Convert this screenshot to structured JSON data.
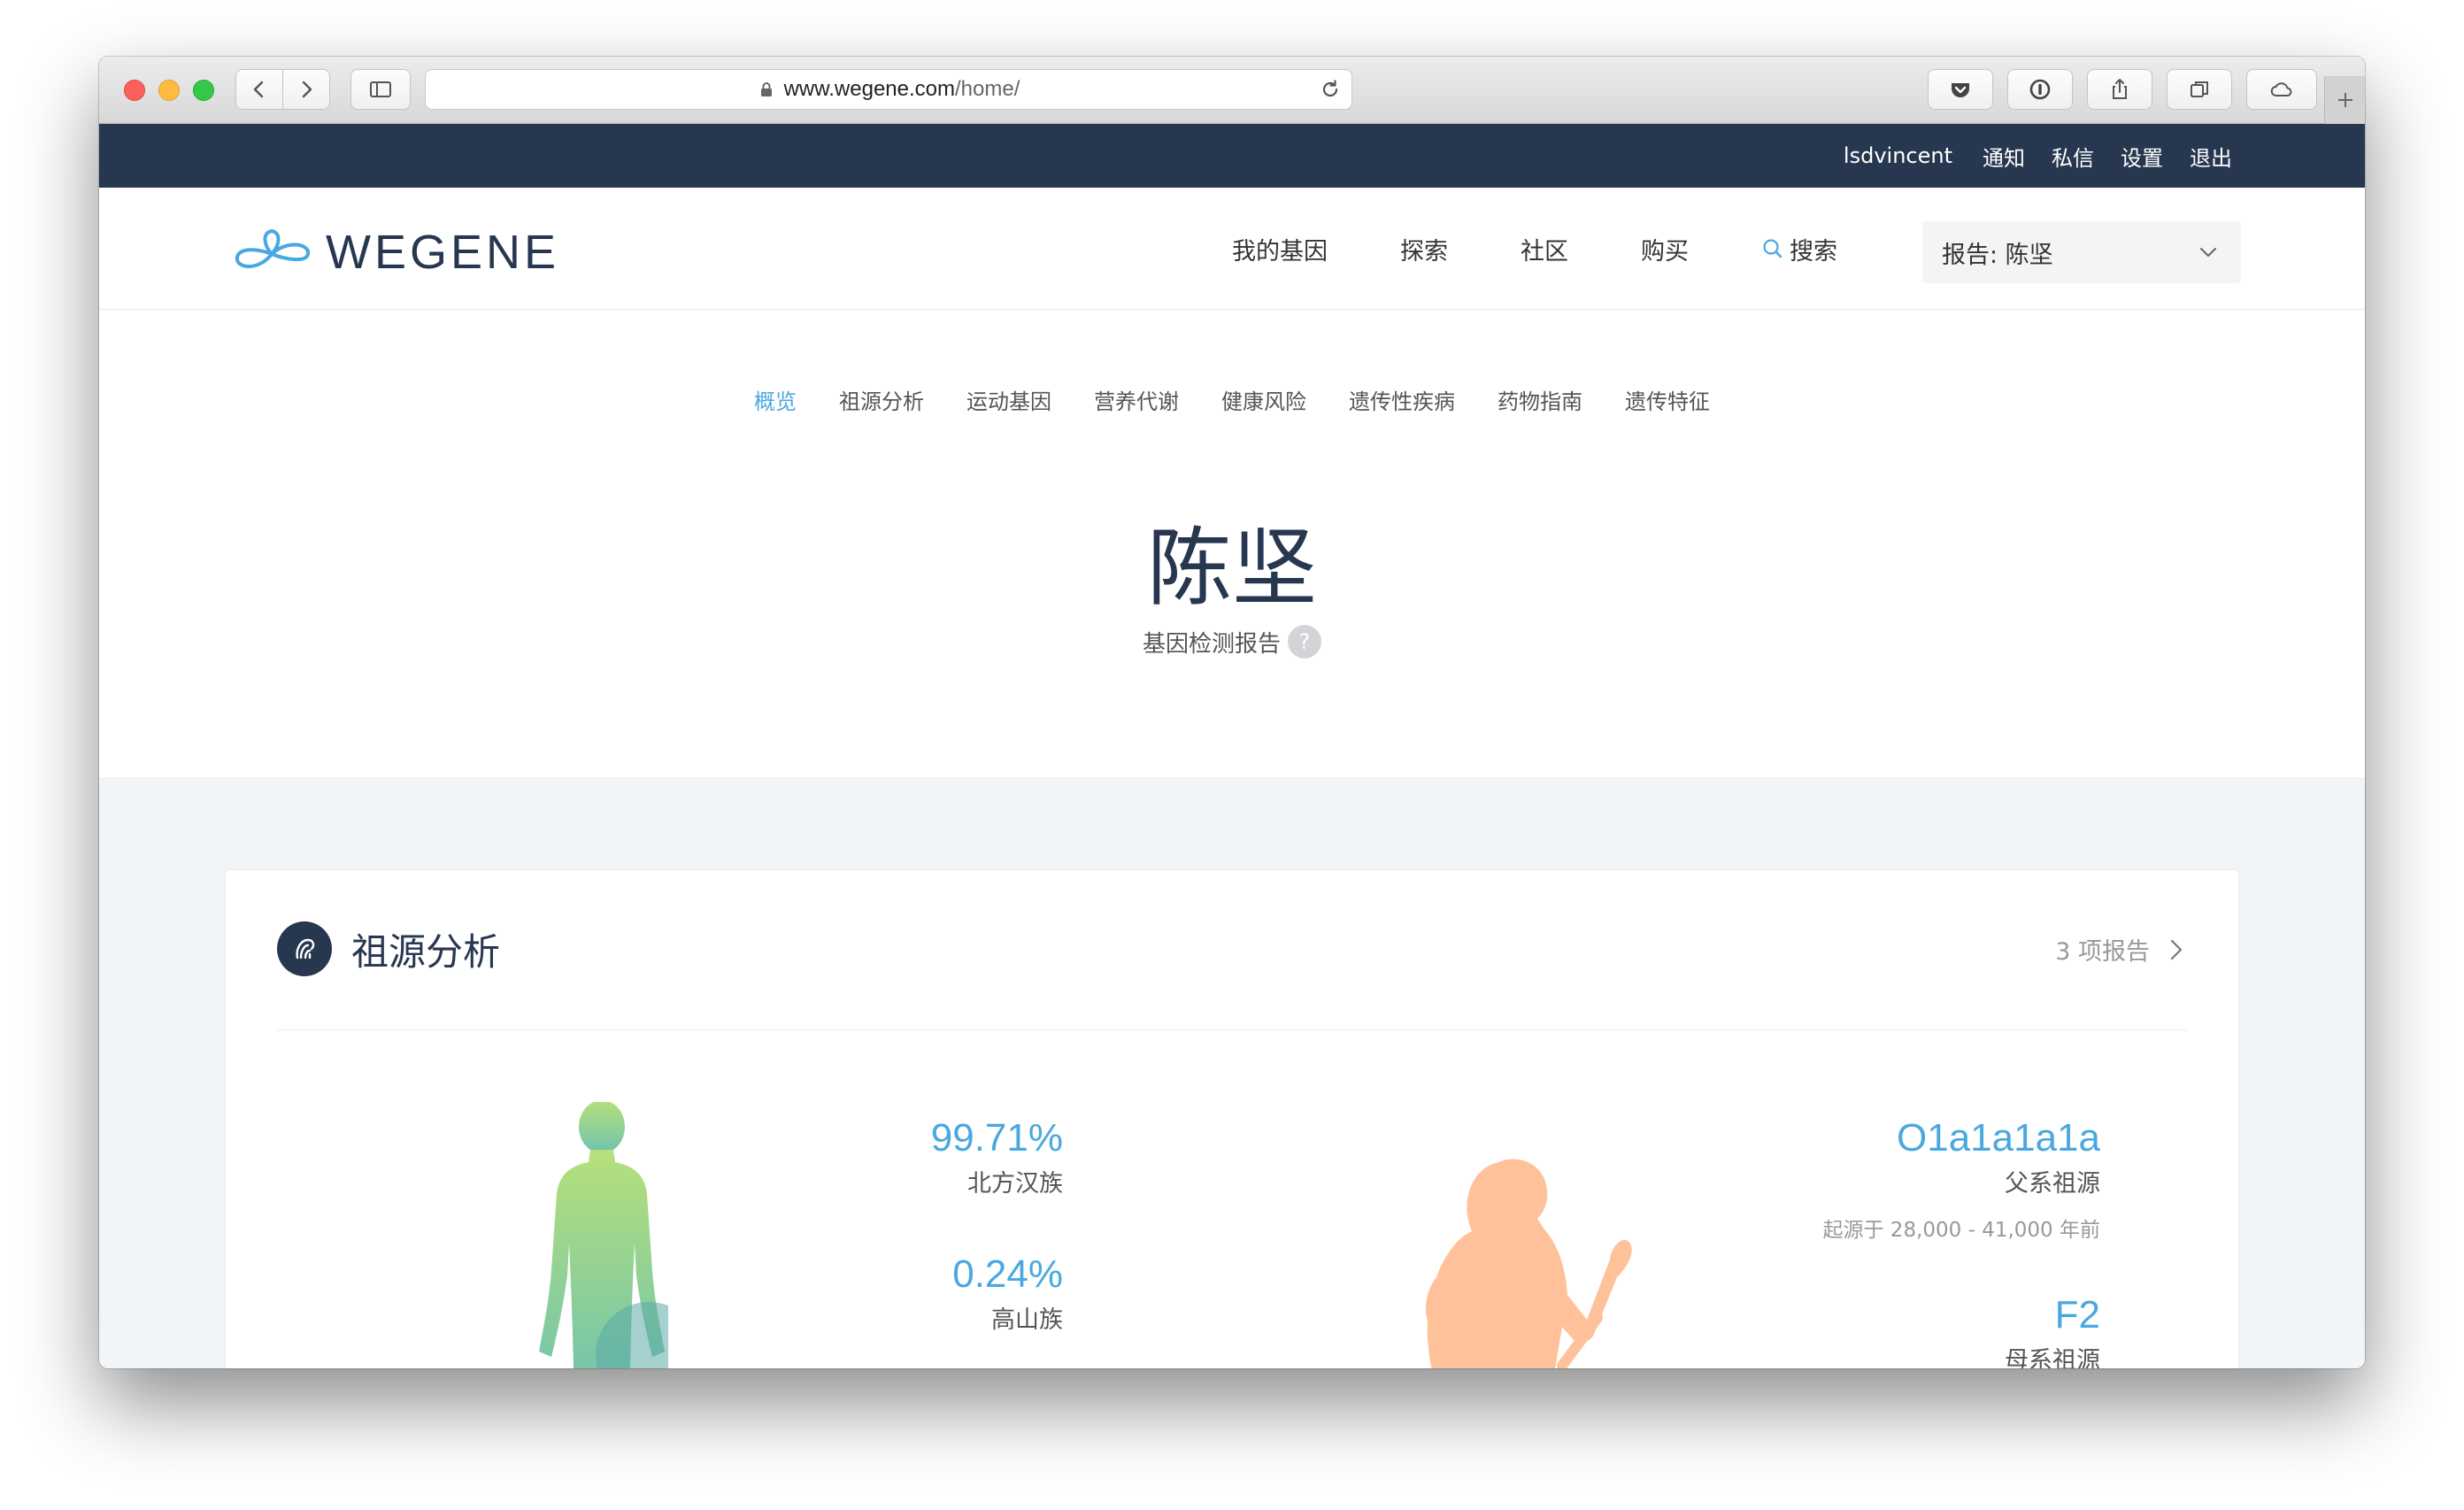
{
  "browser": {
    "url_domain": "www.wegene.com",
    "url_path": "/home/"
  },
  "topbar": {
    "username": "lsdvincent",
    "links": [
      "通知",
      "私信",
      "设置",
      "退出"
    ]
  },
  "brand": {
    "name": "WEGENE",
    "color": "#283750"
  },
  "nav": {
    "items": [
      "我的基因",
      "探索",
      "社区",
      "购买"
    ],
    "search_label": "搜索",
    "report_select": "报告: 陈坚"
  },
  "subnav": {
    "items": [
      "概览",
      "祖源分析",
      "运动基因",
      "营养代谢",
      "健康风险",
      "遗传性疾病",
      "药物指南",
      "遗传特征"
    ],
    "active_index": 0
  },
  "hero": {
    "name": "陈坚",
    "subtitle": "基因检测报告",
    "help_mark": "?"
  },
  "ancestry_card": {
    "title": "祖源分析",
    "report_count": "3 项报告",
    "ethnicity": [
      {
        "value": "99.71%",
        "label": "北方汉族"
      },
      {
        "value": "0.24%",
        "label": "高山族"
      }
    ],
    "paternal": {
      "haplogroup": "O1a1a1a1a",
      "label": "父系祖源",
      "note": "起源于 28,000 - 41,000 年前"
    },
    "maternal": {
      "haplogroup": "F2",
      "label": "母系祖源"
    }
  },
  "colors": {
    "accent": "#4aa8e0",
    "dark": "#283750",
    "section_bg": "#f2f5f8"
  }
}
